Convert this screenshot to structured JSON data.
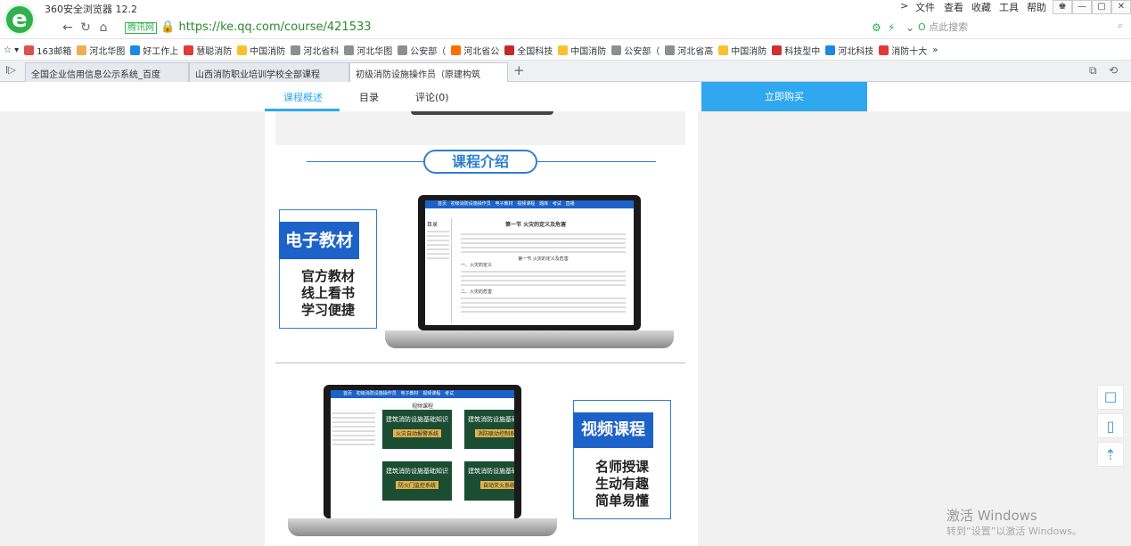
{
  "browser": {
    "name": "360安全浏览器 12.2",
    "menu": [
      "文件",
      "查看",
      "收藏",
      "工具",
      "帮助"
    ]
  },
  "address": {
    "site_badge": "腾讯网",
    "url": "https://ke.qq.com/course/421533",
    "search_placeholder": "点此搜索"
  },
  "bookmarks": [
    "163邮箱",
    "河北华图",
    "好工作上",
    "慧聪消防",
    "中国消防",
    "河北省科",
    "河北华图",
    "公安部（",
    "河北省公",
    "全国科技",
    "中国消防",
    "公安部（",
    "河北省高",
    "中国消防",
    "科技型中",
    "河北科技",
    "消防十大"
  ],
  "tabs": [
    {
      "label": "全国企业信用信息公示系统_百度"
    },
    {
      "label": "山西消防职业培训学校全部课程"
    },
    {
      "label": "初级消防设施操作员（原建构筑"
    }
  ],
  "subnav": {
    "tabs": [
      "课程概述",
      "目录",
      "评论(0)"
    ],
    "buy": "立即购买"
  },
  "content": {
    "section_title": "课程介绍",
    "ebook": {
      "badge": "电子教材",
      "lines": [
        "官方教材",
        "线上看书",
        "学习便捷"
      ],
      "doc_title": "第一节 火灾的定义及危害",
      "doc_sub": "第一节 火灾的定义及危害",
      "h1": "一、火灾的定义",
      "h2": "二、火灾的危害"
    },
    "video": {
      "badge": "视频课程",
      "lines": [
        "名师授课",
        "生动有趣",
        "简单易懂"
      ],
      "page_title": "视频课程",
      "card_title": "建筑消防设施基础知识",
      "cards": [
        "火灾自动报警系统",
        "消防联动控制系统",
        "防火门监控系统",
        "自动灭火系统"
      ]
    }
  },
  "watermark": {
    "line1": "激活 Windows",
    "line2": "转到“设置”以激活 Windows。"
  },
  "colors": {
    "accent": "#2fa8ef",
    "badge": "#1c62c9"
  }
}
